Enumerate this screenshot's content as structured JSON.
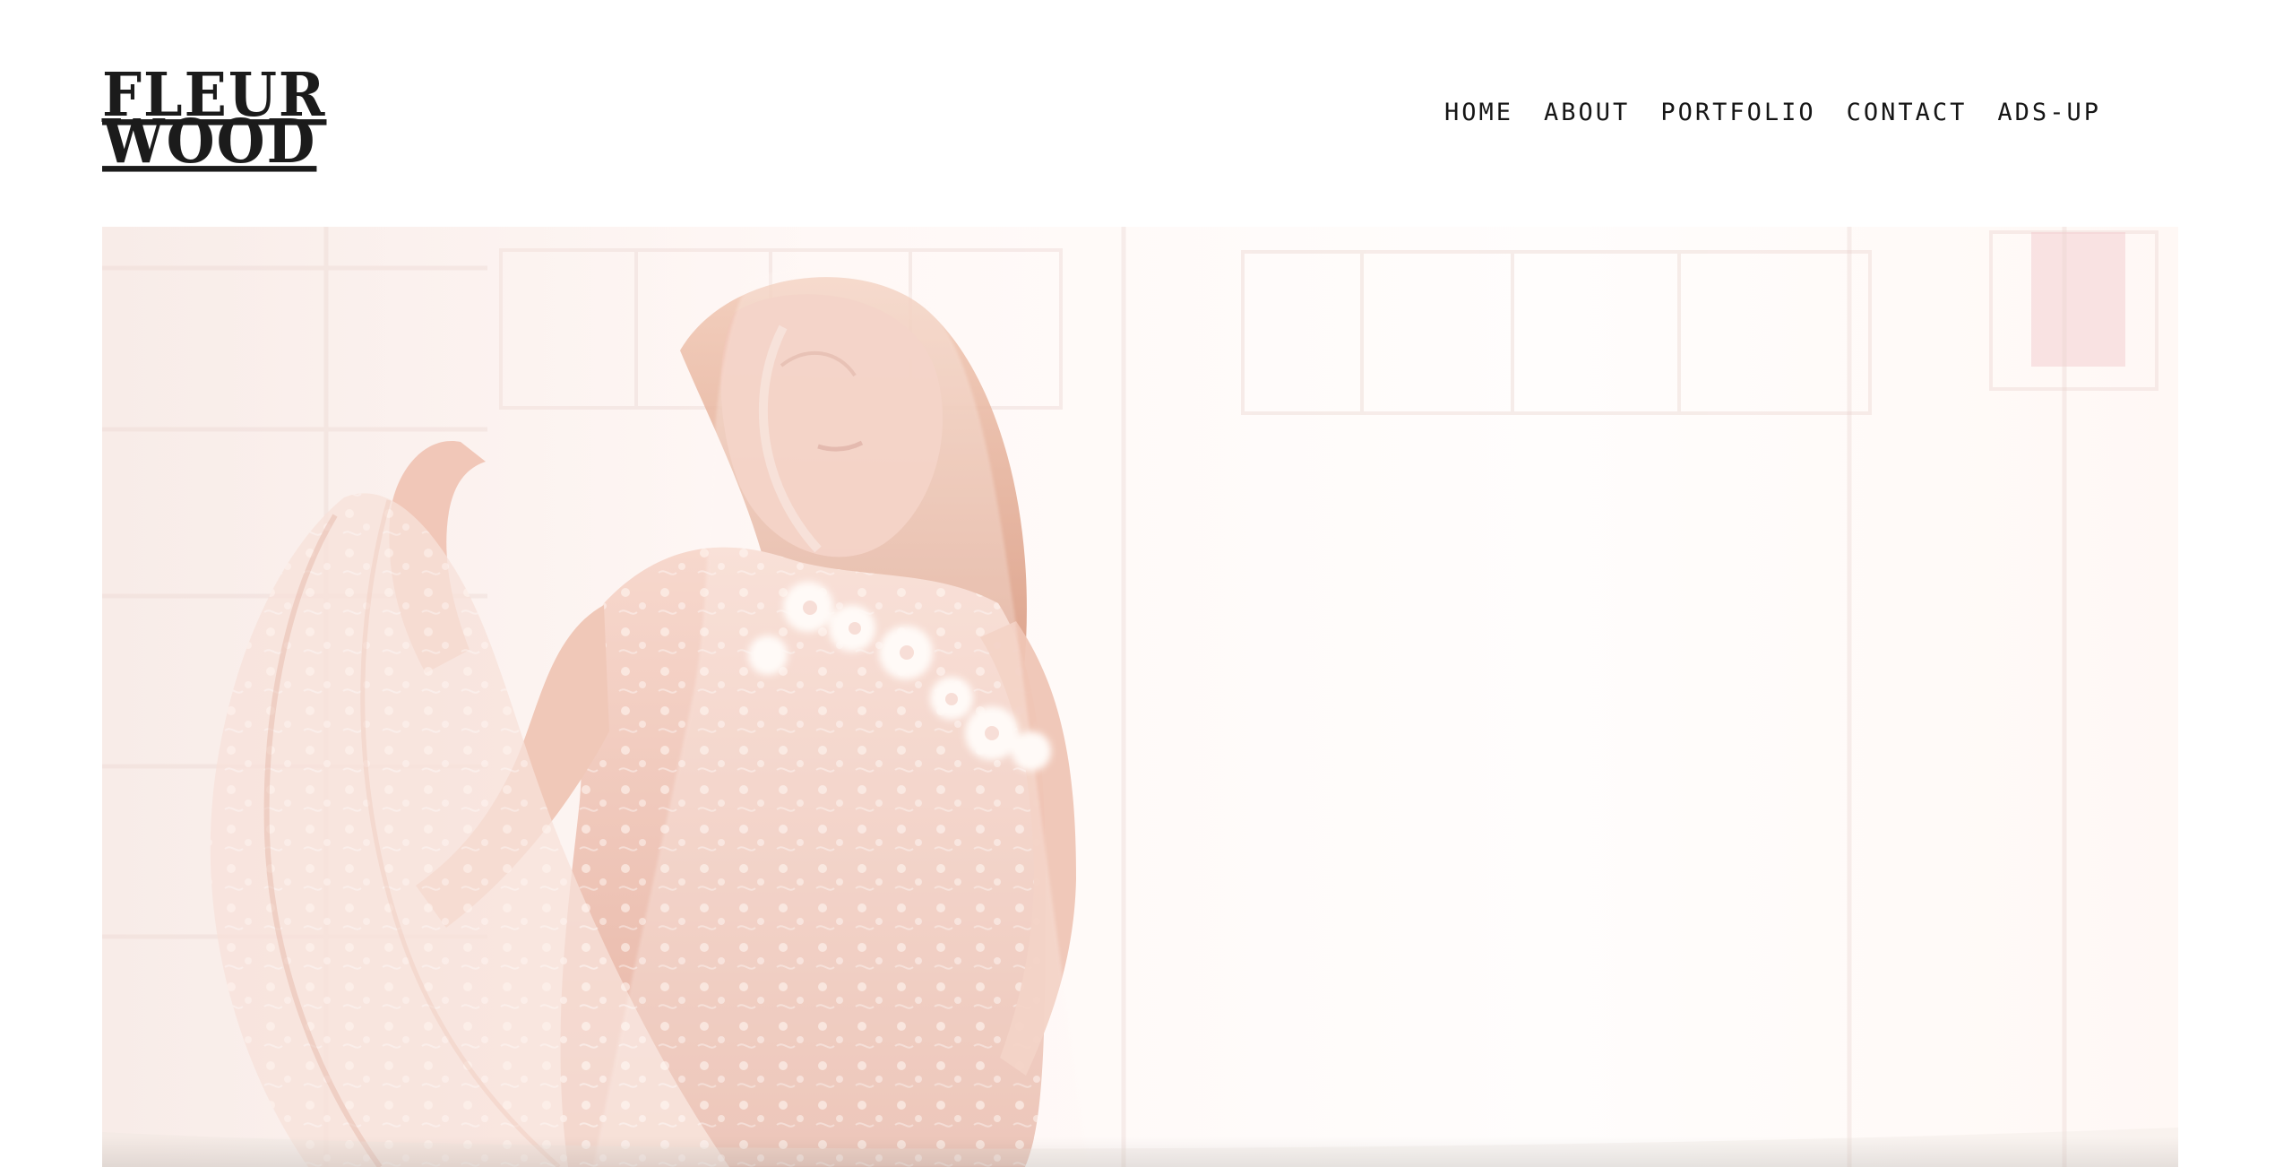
{
  "brand": {
    "line1": "FLEUR",
    "line2": "WOOD"
  },
  "nav": {
    "items": [
      {
        "label": "HOME"
      },
      {
        "label": "ABOUT"
      },
      {
        "label": "PORTFOLIO"
      },
      {
        "label": "CONTACT"
      },
      {
        "label": "ADS-UP"
      }
    ]
  },
  "colors": {
    "text": "#161616",
    "background": "#ffffff",
    "hero_tint": "#f8e7df",
    "accent_blush": "#e9c2b4"
  },
  "hero": {
    "icon": "hero-photo"
  }
}
